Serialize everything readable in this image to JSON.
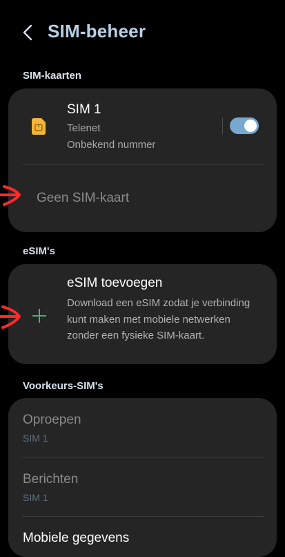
{
  "header": {
    "title": "SIM-beheer",
    "back_icon": "chevron-left-icon"
  },
  "sim_cards": {
    "section_label": "SIM-kaarten",
    "sim1": {
      "name": "SIM 1",
      "carrier": "Telenet",
      "number": "Onbekend nummer",
      "enabled": true,
      "icon": "sim-card-icon",
      "icon_color": "#f2b53a"
    },
    "empty_slot": "Geen SIM-kaart"
  },
  "esims": {
    "section_label": "eSIM's",
    "add": {
      "title": "eSIM toevoegen",
      "description": "Download een eSIM zodat je verbinding kunt maken met mobiele netwerken zonder een fysieke SIM-kaart.",
      "icon": "plus-icon",
      "icon_color": "#3db86a"
    }
  },
  "preferred": {
    "section_label": "Voorkeurs-SIM's",
    "items": [
      {
        "title": "Oproepen",
        "value": "SIM 1"
      },
      {
        "title": "Berichten",
        "value": "SIM 1"
      },
      {
        "title": "Mobiele gegevens",
        "value": ""
      }
    ]
  },
  "colors": {
    "accent": "#79a8cf",
    "title": "#b8d1e6",
    "annotation": "#ff2a2a",
    "card": "#252525"
  }
}
